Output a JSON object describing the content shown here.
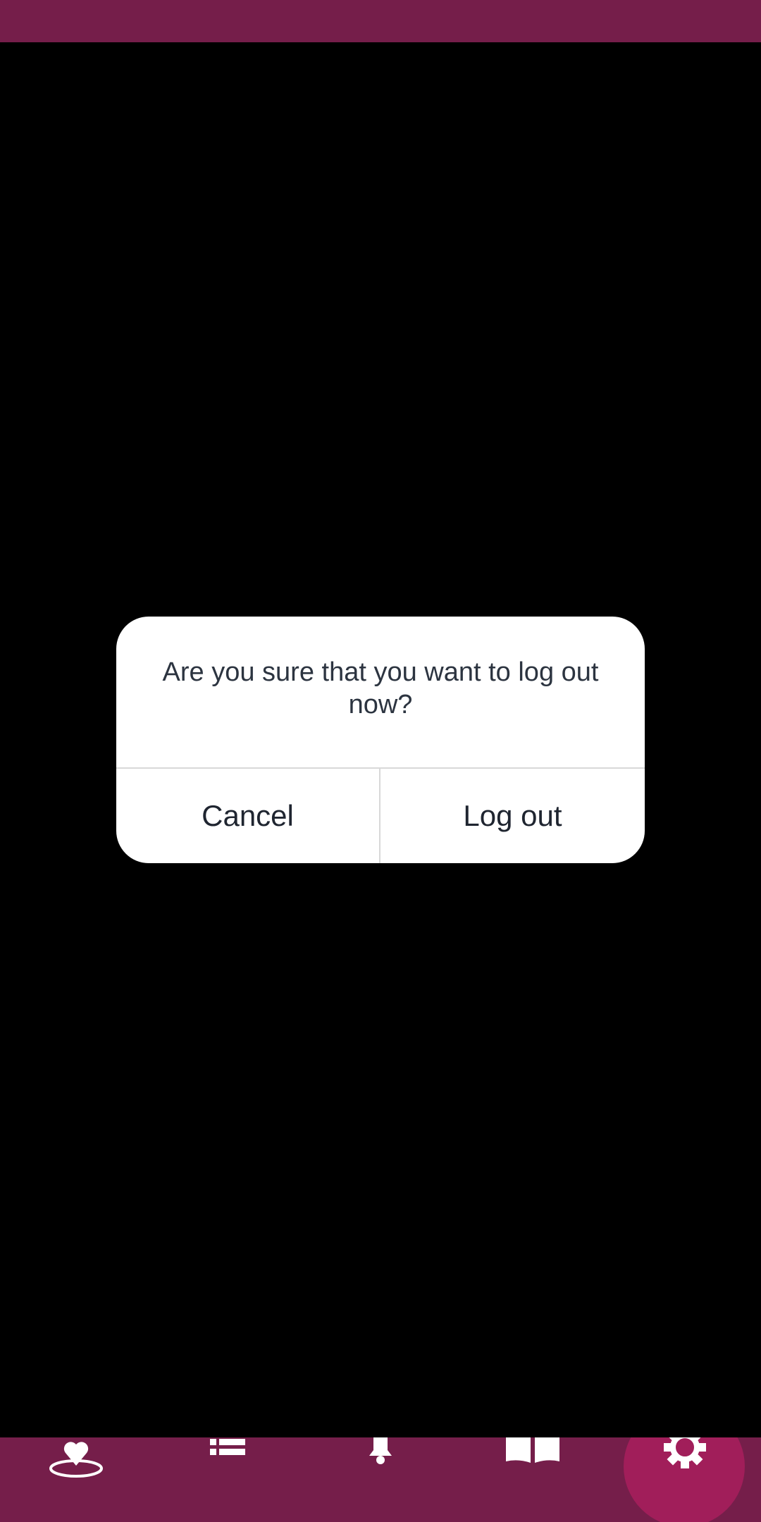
{
  "colors": {
    "brand": "#751e4a",
    "nav_active": "#a11e5a",
    "dialog_bg": "#ffffff",
    "overlay": "#000000"
  },
  "dialog": {
    "message": "Are you sure that you want to log out now?",
    "cancel_label": "Cancel",
    "confirm_label": "Log out"
  },
  "bottom_nav": {
    "items": [
      {
        "icon": "location-heart-icon",
        "active": false
      },
      {
        "icon": "list-icon",
        "active": false
      },
      {
        "icon": "bell-icon",
        "active": false
      },
      {
        "icon": "book-icon",
        "active": false
      },
      {
        "icon": "gear-icon",
        "active": true
      }
    ]
  }
}
